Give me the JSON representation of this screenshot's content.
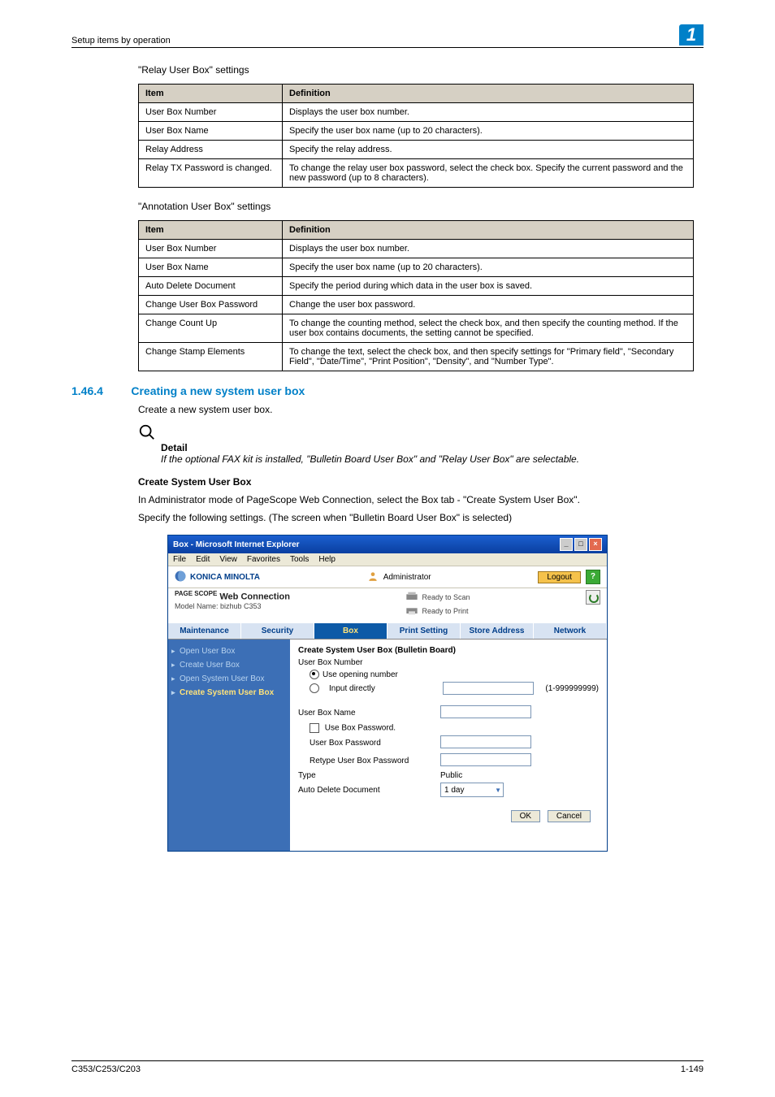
{
  "header": {
    "breadcrumb": "Setup items by operation",
    "chapter": "1"
  },
  "relay": {
    "caption": "\"Relay User Box\" settings",
    "col1": "Item",
    "col2": "Definition",
    "rows": [
      {
        "item": "User Box Number",
        "def": "Displays the user box number."
      },
      {
        "item": "User Box Name",
        "def": "Specify the user box name (up to 20 characters)."
      },
      {
        "item": "Relay Address",
        "def": "Specify the relay address."
      },
      {
        "item": "Relay TX Password is changed.",
        "def": "To change the relay user box password, select the check box. Specify the current password and the new password (up to 8 characters)."
      }
    ]
  },
  "annotation": {
    "caption": "\"Annotation User Box\" settings",
    "col1": "Item",
    "col2": "Definition",
    "rows": [
      {
        "item": "User Box Number",
        "def": "Displays the user box number."
      },
      {
        "item": "User Box Name",
        "def": "Specify the user box name (up to 20 characters)."
      },
      {
        "item": "Auto Delete Document",
        "def": "Specify the period during which data in the user box is saved."
      },
      {
        "item": "Change User Box Password",
        "def": "Change the user box password."
      },
      {
        "item": "Change Count Up",
        "def": "To change the counting method, select the check box, and then specify the counting method. If the user box contains documents, the setting cannot be specified."
      },
      {
        "item": "Change Stamp Elements",
        "def": "To change the text, select the check box, and then specify settings for \"Primary field\", \"Secondary Field\", \"Date/Time\", \"Print Position\", \"Density\", and \"Number Type\"."
      }
    ]
  },
  "section": {
    "num": "1.46.4",
    "title": "Creating a new system user box",
    "intro": "Create a new system user box.",
    "detail_label": "Detail",
    "detail_text": "If the optional FAX kit is installed, \"Bulletin Board User Box\" and \"Relay User Box\" are selectable.",
    "sub_heading": "Create System User Box",
    "body1": "In Administrator mode of PageScope Web Connection, select the Box tab - \"Create System User Box\".",
    "body2": "Specify the following settings. (The screen when \"Bulletin Board User Box\" is selected)"
  },
  "screenshot": {
    "window_title": "Box - Microsoft Internet Explorer",
    "menu": {
      "file": "File",
      "edit": "Edit",
      "view": "View",
      "favorites": "Favorites",
      "tools": "Tools",
      "help": "Help"
    },
    "brand": "KONICA MINOLTA",
    "admin": "Administrator",
    "logout": "Logout",
    "webconn": "Web Connection",
    "pagescope": "PAGE SCOPE",
    "model": "Model Name: bizhub C353",
    "ready_scan": "Ready to Scan",
    "ready_print": "Ready to Print",
    "tabs": [
      "Maintenance",
      "Security",
      "Box",
      "Print Setting",
      "Store Address",
      "Network"
    ],
    "active_tab": "Box",
    "side": [
      {
        "label": "Open User Box",
        "state": "dim"
      },
      {
        "label": "Create User Box",
        "state": "dim"
      },
      {
        "label": "Open System User Box",
        "state": "dim"
      },
      {
        "label": "Create System User Box",
        "state": "active"
      }
    ],
    "panel_title": "Create System User Box (Bulletin Board)",
    "fields": {
      "ubn": "User Box Number",
      "use_opening": "Use opening number",
      "input_directly": "Input directly",
      "range": "(1-999999999)",
      "ubname": "User Box Name",
      "use_pw": "Use Box Password.",
      "ubpw": "User Box Password",
      "retype": "Retype User Box Password",
      "type": "Type",
      "type_val": "Public",
      "auto_del": "Auto Delete Document",
      "auto_del_val": "1 day"
    },
    "ok": "OK",
    "cancel": "Cancel"
  },
  "footer": {
    "left": "C353/C253/C203",
    "right": "1-149"
  }
}
